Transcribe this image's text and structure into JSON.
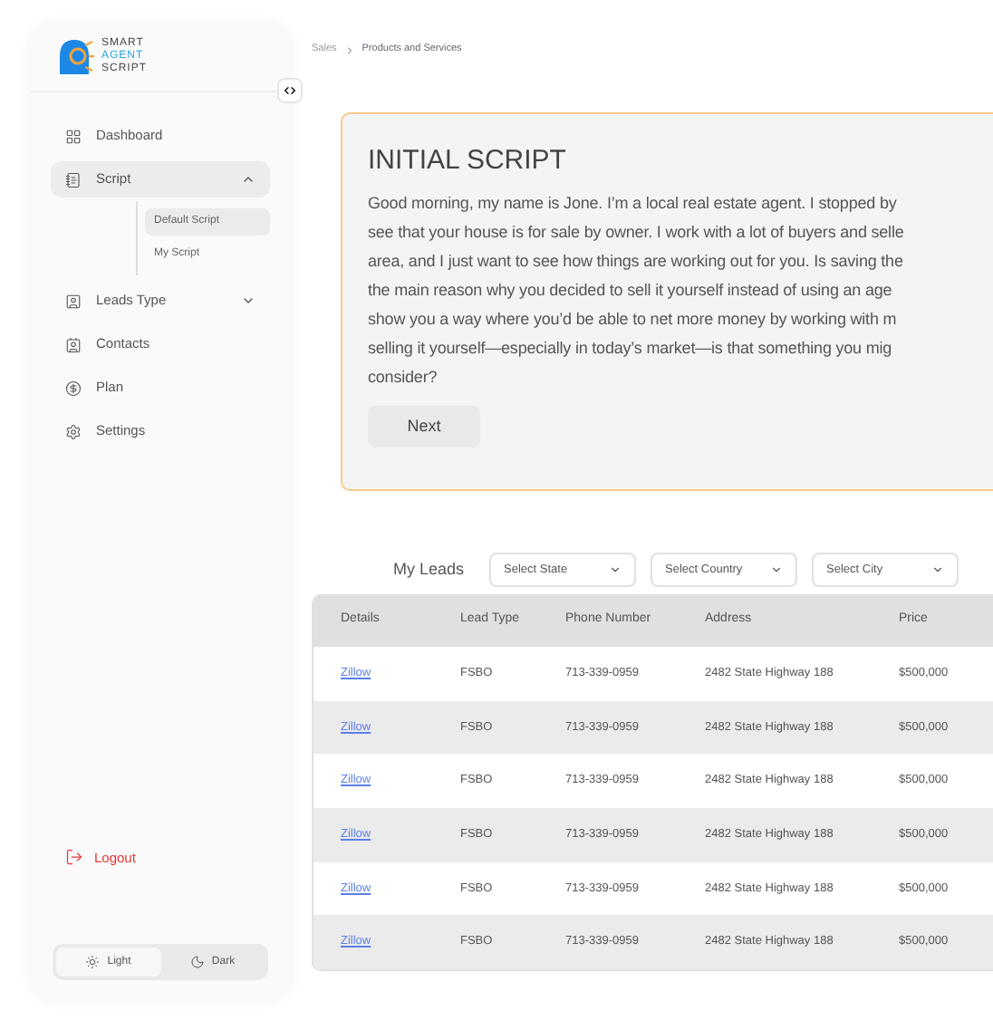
{
  "logo": {
    "lines": [
      "SMART",
      "AGENT",
      "SCRIPT"
    ]
  },
  "sidebar": {
    "items": [
      {
        "label": "Dashboard"
      },
      {
        "label": "Script",
        "expanded": true,
        "selected": true,
        "children": [
          {
            "label": "Default Script",
            "selected": true
          },
          {
            "label": "My Script",
            "selected": false
          }
        ]
      },
      {
        "label": "Leads Type",
        "expanded": false
      },
      {
        "label": "Contacts"
      },
      {
        "label": "Plan"
      },
      {
        "label": "Settings"
      }
    ],
    "logout": "Logout",
    "theme": [
      {
        "label": "Light",
        "selected": true
      },
      {
        "label": "Dark",
        "selected": false
      }
    ]
  },
  "breadcrumb": [
    "Sales",
    "Products and Services"
  ],
  "script": {
    "title": "INITIAL SCRIPT",
    "lines": [
      "Good morning, my name is Jone. I’m a local real estate agent. I stopped by",
      "see that your house is for sale by owner. I work with a lot of buyers and selle",
      "area, and I just want to see how things are working out for you. Is saving the",
      "the main reason why you decided to sell it yourself instead of using an age",
      "show you a way where you’d be able to net more money by working with m",
      "selling it yourself—especially in today’s market—is that something you mig",
      "consider?"
    ],
    "button": "Next"
  },
  "leads": {
    "title": "My Leads",
    "filters": [
      "Select State",
      "Select Country",
      "Select City"
    ]
  },
  "table": {
    "columns": [
      "Details",
      "Lead Type",
      "Phone Number",
      "Address",
      "Price"
    ],
    "rows": [
      [
        "Zillow",
        "FSBO",
        "713-339-0959",
        "2482 State Highway 188",
        "$500,000"
      ],
      [
        "Zillow",
        "FSBO",
        "713-339-0959",
        "2482 State Highway 188",
        "$500,000"
      ],
      [
        "Zillow",
        "FSBO",
        "713-339-0959",
        "2482 State Highway 188",
        "$500,000"
      ],
      [
        "Zillow",
        "FSBO",
        "713-339-0959",
        "2482 State Highway 188",
        "$500,000"
      ],
      [
        "Zillow",
        "FSBO",
        "713-339-0959",
        "2482 State Highway 188",
        "$500,000"
      ],
      [
        "Zillow",
        "FSBO",
        "713-339-0959",
        "2482 State Highway 188",
        "$500,000"
      ]
    ]
  }
}
